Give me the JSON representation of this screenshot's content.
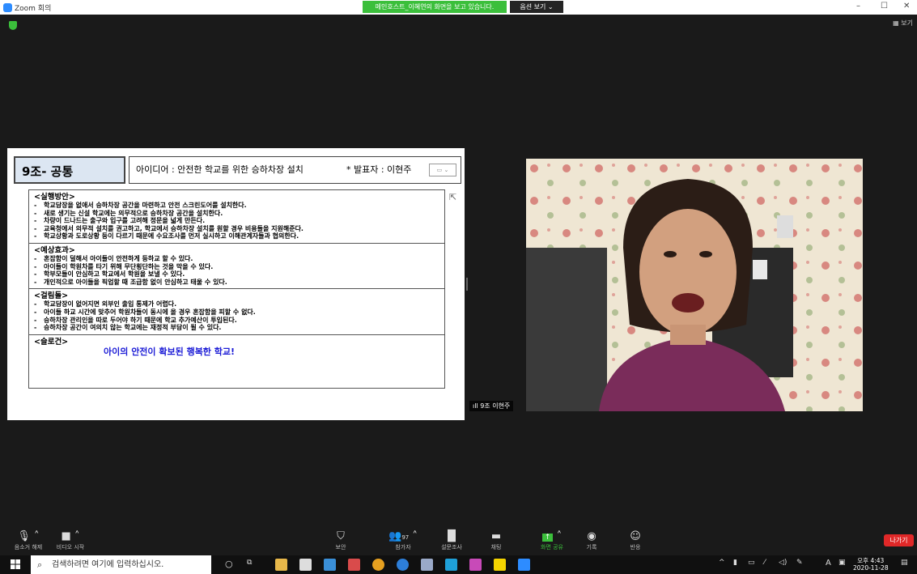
{
  "titlebar": {
    "app_title": "Zoom 회의",
    "share_banner": "메인호스트_이혜연의 화면을 보고 있습니다.",
    "view_options": "옵션 보기 ⌄",
    "minimize": "–",
    "maximize": "☐",
    "close": "✕"
  },
  "view_button": "보기",
  "slide": {
    "team": "9조- 공통",
    "idea": "아이디어 : 안전한 학교를 위한 승하차장 설치",
    "presenter": "* 발표자 : 이현주",
    "dropdown": "▭ ⌄",
    "sections": [
      {
        "heading": "<실행방안>",
        "items": [
          "학교담장을 없애서 승하차장 공간을 마련하고 안전 스크린도어를 설치한다.",
          "새로 생기는 신설 학교에는 의무적으로 승하차장 공간을 설치한다.",
          "차량이 드나드는 출구와 입구를 고려해 정문을 넓게 만든다.",
          "교육청에서 의무적 설치를 권고하고, 학교에서 승하차장 설치를 원할 경우 비용들을 지원해준다.",
          "학교상황과 도로상황 등이 다르기 때문에 수요조사를 먼저 실시하고 이해관계자들과 협의한다."
        ]
      },
      {
        "heading": "<예상효과>",
        "items": [
          "혼잡함이 덜해서 아이들이 안전하게 등하교 할 수 있다.",
          "아이들이 학원차를 타기 위해 무단횡단하는 것을 막을 수 있다.",
          "학부모들이 안심하고 학교에서 학원을 보낼 수 있다.",
          "개인적으로 아이들을 픽업할 때 조급함 없이 안심하고 태울 수 있다."
        ]
      },
      {
        "heading": "<걸림돌>",
        "items": [
          "학교담장이 없어지면 외부인 출입 통제가 어렵다.",
          "아이들 하교 시간에 맞추어 학원차들이 동시에 올 경우 혼잡함을 피할 수 없다.",
          "승하차장 관리인을 따로 두어야 하기 때문에 학교 추가예산이 투입된다.",
          "승하차장 공간이 여의치 않는 학교에는 재정적 부담이 될 수 있다."
        ]
      },
      {
        "heading": "<슬로건>",
        "slogan": "아이의 안전이 확보된 행복한 학교!"
      }
    ]
  },
  "video": {
    "name_tag": "9조 이현주"
  },
  "toolbar": {
    "mute": "음소거 해제",
    "video": "비디오 시작",
    "security": "보안",
    "participants": "참가자",
    "participants_count": "97",
    "polls": "설문조사",
    "chat": "채팅",
    "share": "화면 공유",
    "record": "기록",
    "reactions": "반응",
    "leave": "나가기"
  },
  "taskbar": {
    "search_placeholder": "검색하려면 여기에 입력하십시오.",
    "time": "오후 4:43",
    "date": "2020-11-28",
    "ime": "A"
  },
  "colors": {
    "banner_green": "#3bbf3b",
    "zoom_blue": "#2d8cff",
    "leave_red": "#e02828",
    "slogan_blue": "#1b1bd6"
  }
}
